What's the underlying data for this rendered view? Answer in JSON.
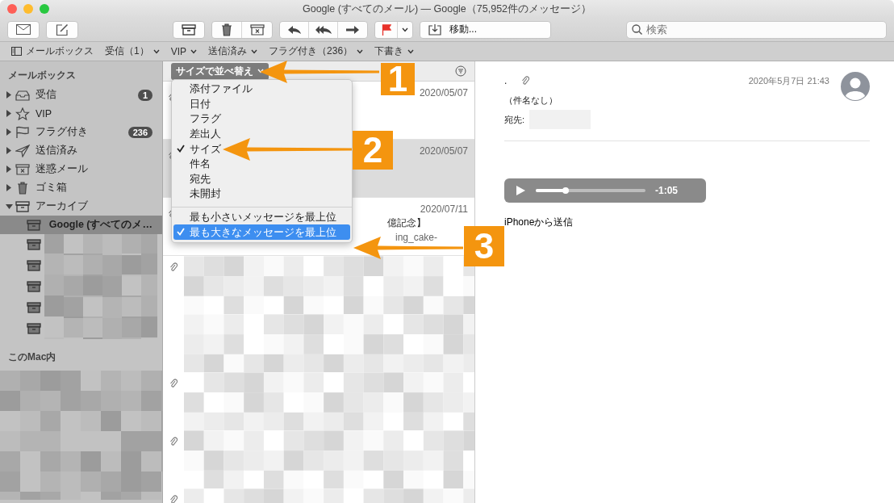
{
  "window": {
    "title": "Google (すべてのメール) — Google（75,952件のメッセージ）"
  },
  "toolbar": {
    "move_button": "移動...",
    "search": {
      "placeholder": "検索"
    }
  },
  "favorites": [
    {
      "label": "メールボックス",
      "kind": "mailboxes"
    },
    {
      "label": "受信（1）",
      "kind": "menu"
    },
    {
      "label": "VIP",
      "kind": "menu"
    },
    {
      "label": "送信済み",
      "kind": "menu"
    },
    {
      "label": "フラグ付き（236）",
      "kind": "menu"
    },
    {
      "label": "下書き",
      "kind": "menu"
    }
  ],
  "sidebar": {
    "title": "メールボックス",
    "items": [
      {
        "label": "受信",
        "kind": "inbox",
        "badge": "1",
        "expanded": false
      },
      {
        "label": "VIP",
        "kind": "star",
        "expanded": false
      },
      {
        "label": "フラグ付き",
        "kind": "flag",
        "badge": "236",
        "expanded": false
      },
      {
        "label": "送信済み",
        "kind": "sent",
        "expanded": false
      },
      {
        "label": "迷惑メール",
        "kind": "junk",
        "expanded": false
      },
      {
        "label": "ゴミ箱",
        "kind": "trash",
        "expanded": false
      },
      {
        "label": "アーカイブ",
        "kind": "archive",
        "expanded": true,
        "children": [
          {
            "label": "Google (すべてのメ…",
            "kind": "mailbox",
            "selected": true
          },
          {
            "kind": "blurred",
            "selected": false
          },
          {
            "kind": "blurred",
            "selected": false
          },
          {
            "kind": "blurred",
            "selected": false
          },
          {
            "kind": "blurred",
            "selected": false
          },
          {
            "kind": "blurred",
            "selected": false
          }
        ]
      }
    ],
    "section_2": {
      "title": "このMac内"
    }
  },
  "message_list": {
    "sort_button": "サイズで並べ替え",
    "messages": [
      {
        "date": "2020/05/07",
        "attachment": true,
        "selected": false
      },
      {
        "date": "2020/05/07",
        "attachment": true,
        "selected": true
      },
      {
        "date": "2020/07/11",
        "attachment": true,
        "selected": false,
        "subject": "億記念】",
        "preview": "ing_cake-"
      }
    ],
    "blurred_rows": [
      {
        "attachment": true
      },
      {
        "attachment": false
      },
      {
        "attachment": true
      },
      {
        "attachment": true
      },
      {
        "attachment": true
      }
    ]
  },
  "sort_menu": {
    "items": [
      {
        "label": "添付ファイル",
        "checked": false
      },
      {
        "label": "日付",
        "checked": false
      },
      {
        "label": "フラグ",
        "checked": false
      },
      {
        "label": "差出人",
        "checked": false
      },
      {
        "label": "サイズ",
        "checked": true
      },
      {
        "label": "件名",
        "checked": false
      },
      {
        "label": "宛先",
        "checked": false
      },
      {
        "label": "未開封",
        "checked": false
      }
    ],
    "order_items": [
      {
        "label": "最も小さいメッセージを最上位",
        "checked": false,
        "selected": false
      },
      {
        "label": "最も大きなメッセージを最上位",
        "checked": true,
        "selected": true
      }
    ]
  },
  "preview": {
    "sender": ".",
    "attachment": true,
    "date": "2020年5月7日 21:43",
    "subject": "（件名なし）",
    "to_label": "宛先:",
    "audio": {
      "level": 0.27,
      "time": "-1:05"
    },
    "body": "iPhoneから送信"
  },
  "annotations": [
    {
      "number": "1"
    },
    {
      "number": "2"
    },
    {
      "number": "3"
    }
  ]
}
